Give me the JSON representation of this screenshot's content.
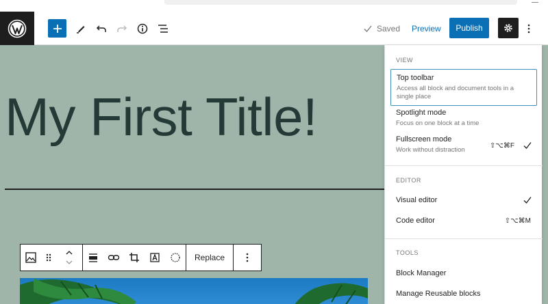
{
  "topbar": {
    "saved_label": "Saved",
    "preview_label": "Preview",
    "publish_label": "Publish"
  },
  "editor": {
    "title": "My First Title!"
  },
  "block_toolbar": {
    "replace_label": "Replace"
  },
  "menu": {
    "view": {
      "label": "VIEW",
      "items": [
        {
          "title": "Top toolbar",
          "description": "Access all block and document tools in a single place"
        },
        {
          "title": "Spotlight mode",
          "description": "Focus on one block at a time"
        },
        {
          "title": "Fullscreen mode",
          "description": "Work without distraction",
          "shortcut": "⇧⌥⌘F"
        }
      ]
    },
    "editor": {
      "label": "EDITOR",
      "items": [
        {
          "title": "Visual editor"
        },
        {
          "title": "Code editor",
          "shortcut": "⇧⌥⌘M"
        }
      ]
    },
    "tools": {
      "label": "TOOLS",
      "items": [
        {
          "title": "Block Manager"
        },
        {
          "title": "Manage Reusable blocks"
        }
      ]
    }
  },
  "colors": {
    "accent": "#0a6fb5",
    "canvas_bg": "#9fb5aa",
    "dark": "#1e1e1e"
  }
}
